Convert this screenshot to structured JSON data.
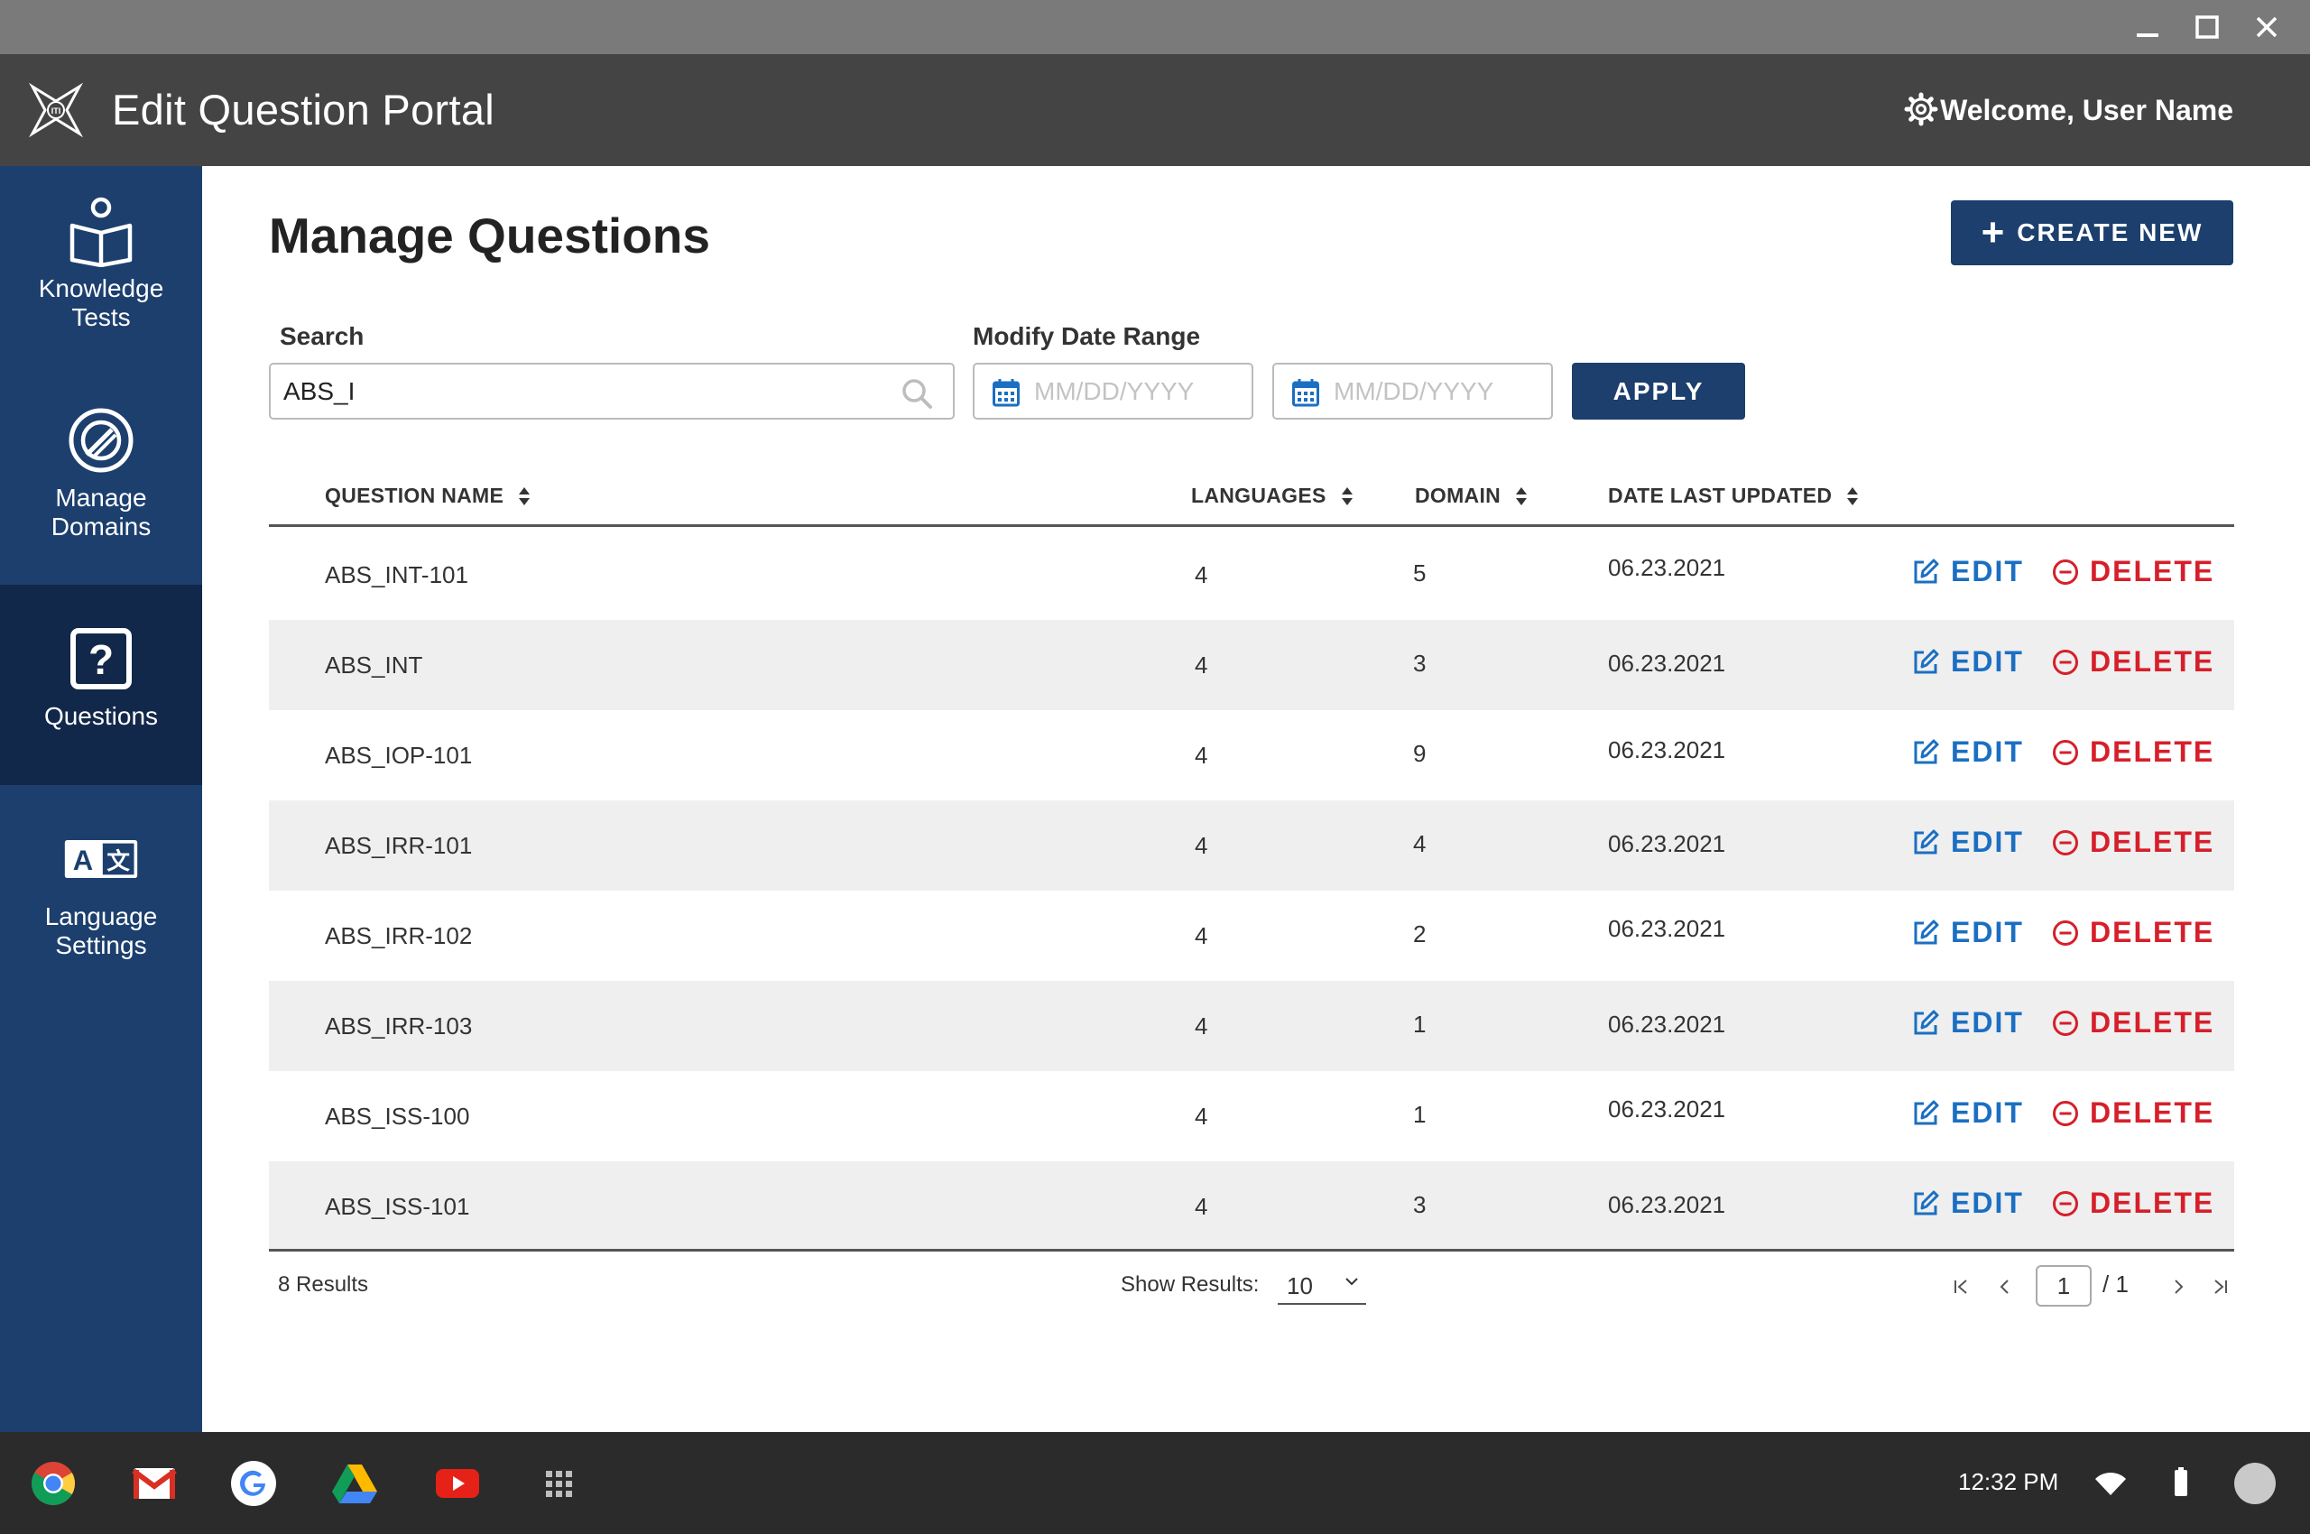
{
  "window": {
    "minimize_icon": "minimize-icon",
    "maximize_icon": "maximize-icon",
    "close_icon": "close-icon"
  },
  "header": {
    "title": "Edit Question Portal",
    "welcome": "Welcome, User Name",
    "logo": "iti-logo",
    "settings_icon": "gear-icon"
  },
  "sidebar": {
    "items": [
      {
        "label": "Knowledge\nTests",
        "icon": "book-reader-icon",
        "active": false
      },
      {
        "label": "Manage\nDomains",
        "icon": "domain-target-icon",
        "active": false
      },
      {
        "label": "Questions",
        "icon": "question-box-icon",
        "active": true
      },
      {
        "label": "Language\nSettings",
        "icon": "translate-icon",
        "active": false
      }
    ]
  },
  "main": {
    "title": "Manage Questions",
    "create_button": "CREATE NEW",
    "search": {
      "label": "Search",
      "value": "ABS_I"
    },
    "date_range": {
      "label": "Modify Date Range",
      "start_placeholder": "MM/DD/YYYY",
      "end_placeholder": "MM/DD/YYYY"
    },
    "apply_button": "APPLY"
  },
  "table": {
    "columns": [
      "QUESTION NAME",
      "LANGUAGES",
      "DOMAIN",
      "DATE LAST UPDATED"
    ],
    "edit_label": "EDIT",
    "delete_label": "DELETE",
    "rows": [
      {
        "name": "ABS_INT-101",
        "languages": "4",
        "domain": "5",
        "date": "06.23.2021"
      },
      {
        "name": "ABS_INT",
        "languages": "4",
        "domain": "3",
        "date": "06.23.2021"
      },
      {
        "name": "ABS_IOP-101",
        "languages": "4",
        "domain": "9",
        "date": "06.23.2021"
      },
      {
        "name": "ABS_IRR-101",
        "languages": "4",
        "domain": "4",
        "date": "06.23.2021"
      },
      {
        "name": "ABS_IRR-102",
        "languages": "4",
        "domain": "2",
        "date": "06.23.2021"
      },
      {
        "name": "ABS_IRR-103",
        "languages": "4",
        "domain": "1",
        "date": "06.23.2021"
      },
      {
        "name": "ABS_ISS-100",
        "languages": "4",
        "domain": "1",
        "date": "06.23.2021"
      },
      {
        "name": "ABS_ISS-101",
        "languages": "4",
        "domain": "3",
        "date": "06.23.2021"
      }
    ]
  },
  "footer": {
    "results": "8 Results",
    "show_label": "Show Results:",
    "show_value": "10",
    "page": "1",
    "page_total": "/ 1"
  },
  "taskbar": {
    "apps": [
      "chrome-icon",
      "gmail-icon",
      "google-icon",
      "drive-icon",
      "youtube-icon",
      "launcher-icon"
    ],
    "time": "12:32 PM",
    "colors": {
      "edit": "#1b6fc2",
      "delete": "#d61f2a",
      "navy": "#1c3f6e"
    }
  }
}
